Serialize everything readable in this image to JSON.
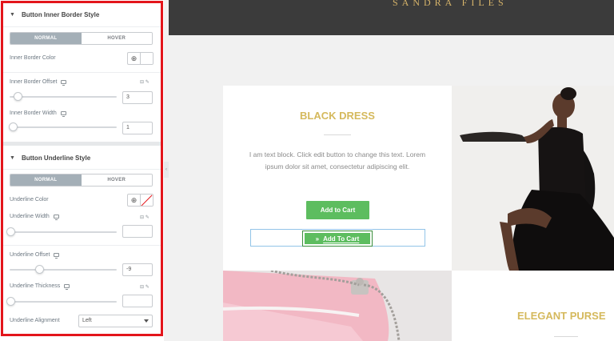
{
  "panel": {
    "inner_border": {
      "title": "Button Inner Border Style",
      "tabs": [
        "NORMAL",
        "HOVER"
      ],
      "color_label": "Inner Border Color",
      "offset_label": "Inner Border Offset",
      "offset_value": "3",
      "offset_fraction": 0.05,
      "width_label": "Inner Border Width",
      "width_value": "1",
      "width_fraction": 0.0,
      "units_icon": "⊟ ✎"
    },
    "underline": {
      "title": "Button Underline Style",
      "tabs": [
        "NORMAL",
        "HOVER"
      ],
      "color_label": "Underline Color",
      "width_label": "Underline Width",
      "width_value": "",
      "offset_label": "Underline Offset",
      "offset_value": "-9",
      "offset_fraction": 0.27,
      "thickness_label": "Underline Thickness",
      "thickness_value": "",
      "alignment_label": "Underline Alignment",
      "alignment_value": "Left",
      "units_icon": "⊟ ✎"
    },
    "globe_icon": "⊕",
    "caret_icon": "▼",
    "handle_icon": "‹"
  },
  "canvas": {
    "site_title": "SANDRA FILES",
    "product1": {
      "heading": "BLACK DRESS",
      "text": "I am text block. Click edit button to change this text. Lorem ipsum dolor sit amet, consectetur adipiscing elit.",
      "button1": "Add to Cart",
      "button2": "Add To Cart",
      "button2_icon": "»"
    },
    "product2": {
      "heading": "ELEGANT PURSE"
    }
  },
  "colors": {
    "accent_gold": "#d5b95c",
    "button_green": "#5dbd5f",
    "highlight_red": "#e3151b",
    "topbar": "#3b3b3b"
  }
}
